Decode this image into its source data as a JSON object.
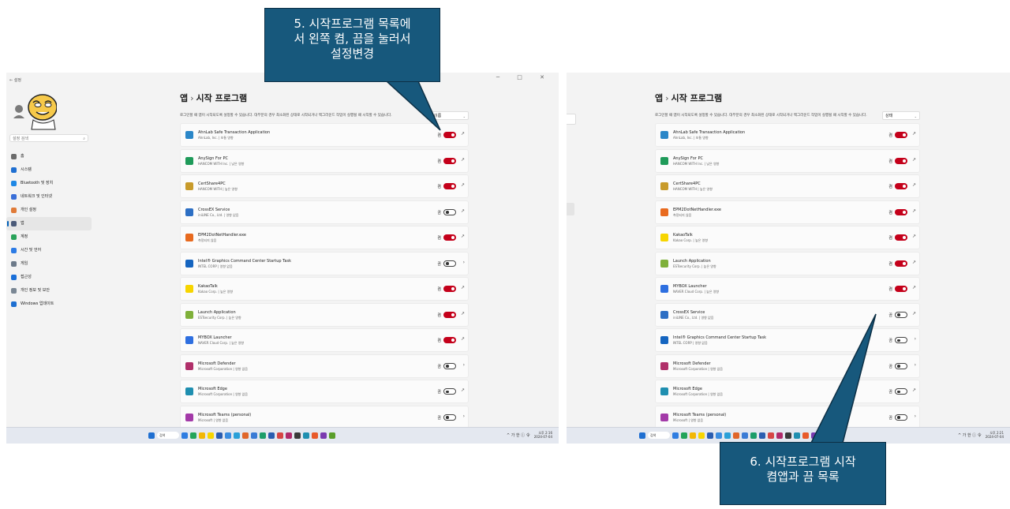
{
  "window": {
    "back_label": "← 설정",
    "controls": "─ □ ✕"
  },
  "sidebar": {
    "search_placeholder": "설정 검색",
    "items": [
      {
        "label": "홈",
        "icon": "home-icon",
        "color": "#6b6b6b"
      },
      {
        "label": "시스템",
        "icon": "system-icon",
        "color": "#1f6fd1"
      },
      {
        "label": "Bluetooth 및 장치",
        "icon": "bluetooth-icon",
        "color": "#1e88e5"
      },
      {
        "label": "네트워크 및 인터넷",
        "icon": "network-icon",
        "color": "#3a6fd8"
      },
      {
        "label": "개인 설정",
        "icon": "brush-icon",
        "color": "#e07b39"
      },
      {
        "label": "앱",
        "icon": "apps-icon",
        "color": "#4a5a78",
        "selected": true
      },
      {
        "label": "계정",
        "icon": "accounts-icon",
        "color": "#2aa35a"
      },
      {
        "label": "시간 및 언어",
        "icon": "time-language-icon",
        "color": "#2c7be5"
      },
      {
        "label": "게임",
        "icon": "gaming-icon",
        "color": "#6c7a89"
      },
      {
        "label": "접근성",
        "icon": "accessibility-icon",
        "color": "#1a6fd8"
      },
      {
        "label": "개인 정보 및 보안",
        "icon": "shield-icon",
        "color": "#7a8794"
      },
      {
        "label": "Windows 업데이트",
        "icon": "update-icon",
        "color": "#1e6fd1"
      }
    ]
  },
  "main": {
    "breadcrumb_root": "앱",
    "breadcrumb_sep": "›",
    "page_title": "시작 프로그램",
    "description": "로그인할 때 앱이 시작되도록 설정할 수 있습니다. 대부분의 경우 최소화된 상태로 시작되거나 백그라운드 작업이 실행될 때 시작할 수 있습니다.",
    "sort_label": "이름",
    "apps": [
      {
        "name": "AhnLab Safe Transaction Application",
        "sub": "AhnLab, Inc. | 보통 영향",
        "state": "켬",
        "on": true,
        "action": "↗",
        "icon_color": "#2b87c8"
      },
      {
        "name": "AnySign For PC",
        "sub": "HANCOM WITH Inc. | 낮은 영향",
        "state": "켬",
        "on": true,
        "action": "↗",
        "icon_color": "#1f9b5a"
      },
      {
        "name": "CertShare4PC",
        "sub": "HANCOM WITH | 높은 영향",
        "state": "켬",
        "on": true,
        "action": "↗",
        "icon_color": "#c89b2b"
      },
      {
        "name": "CrossEX Service",
        "sub": "iniLINE Co., Ltd. | 영향 없음",
        "state": "끔",
        "on": false,
        "action": "↗",
        "icon_color": "#2d6fc4"
      },
      {
        "name": "EPM2DotNetHandler.exe",
        "sub": "측정되지 않음",
        "state": "켬",
        "on": true,
        "action": "↗",
        "icon_color": "#e86a1f"
      },
      {
        "name": "Intel® Graphics Command Center Startup Task",
        "sub": "INTEL CORP | 영향 없음",
        "state": "끔",
        "on": false,
        "action": "›",
        "icon_color": "#1565c0"
      },
      {
        "name": "KakaoTalk",
        "sub": "Kakao Corp. | 높은 영향",
        "state": "켬",
        "on": true,
        "action": "↗",
        "icon_color": "#f7d500"
      },
      {
        "name": "Launch Application",
        "sub": "ESTsecurity Corp. | 높은 영향",
        "state": "켬",
        "on": true,
        "action": "↗",
        "icon_color": "#7fb03a"
      },
      {
        "name": "MYBOX Launcher",
        "sub": "NAVER Cloud Corp. | 높은 영향",
        "state": "켬",
        "on": true,
        "action": "↗",
        "icon_color": "#2e6fe0"
      },
      {
        "name": "Microsoft Defender",
        "sub": "Microsoft Corporation | 영향 없음",
        "state": "끔",
        "on": false,
        "action": "›",
        "icon_color": "#b0306a"
      },
      {
        "name": "Microsoft Edge",
        "sub": "Microsoft Corporation | 영향 없음",
        "state": "끔",
        "on": false,
        "action": "↗",
        "icon_color": "#1f8fb0"
      },
      {
        "name": "Microsoft Teams (personal)",
        "sub": "Microsoft | 영향 없음",
        "state": "끔",
        "on": false,
        "action": "›",
        "icon_color": "#a33aa8"
      }
    ]
  },
  "main_right": {
    "sort_label": "상태",
    "apps": [
      {
        "name": "AhnLab Safe Transaction Application",
        "sub": "AhnLab, Inc. | 보통 영향",
        "state": "켬",
        "on": true,
        "action": "↗",
        "icon_color": "#2b87c8"
      },
      {
        "name": "AnySign For PC",
        "sub": "HANCOM WITH Inc. | 낮은 영향",
        "state": "켬",
        "on": true,
        "action": "↗",
        "icon_color": "#1f9b5a"
      },
      {
        "name": "CertShare4PC",
        "sub": "HANCOM WITH | 높은 영향",
        "state": "켬",
        "on": true,
        "action": "↗",
        "icon_color": "#c89b2b"
      },
      {
        "name": "EPM2DotNetHandler.exe",
        "sub": "측정되지 않음",
        "state": "켬",
        "on": true,
        "action": "↗",
        "icon_color": "#e86a1f"
      },
      {
        "name": "KakaoTalk",
        "sub": "Kakao Corp. | 높은 영향",
        "state": "켬",
        "on": true,
        "action": "↗",
        "icon_color": "#f7d500"
      },
      {
        "name": "Launch Application",
        "sub": "ESTsecurity Corp. | 높은 영향",
        "state": "켬",
        "on": true,
        "action": "↗",
        "icon_color": "#7fb03a"
      },
      {
        "name": "MYBOX Launcher",
        "sub": "NAVER Cloud Corp. | 높은 영향",
        "state": "켬",
        "on": true,
        "action": "↗",
        "icon_color": "#2e6fe0"
      },
      {
        "name": "CrossEX Service",
        "sub": "iniLINE Co., Ltd. | 영향 없음",
        "state": "끔",
        "on": false,
        "action": "↗",
        "icon_color": "#2d6fc4"
      },
      {
        "name": "Intel® Graphics Command Center Startup Task",
        "sub": "INTEL CORP | 영향 없음",
        "state": "끔",
        "on": false,
        "action": "›",
        "icon_color": "#1565c0"
      },
      {
        "name": "Microsoft Defender",
        "sub": "Microsoft Corporation | 영향 없음",
        "state": "끔",
        "on": false,
        "action": "›",
        "icon_color": "#b0306a"
      },
      {
        "name": "Microsoft Edge",
        "sub": "Microsoft Corporation | 영향 없음",
        "state": "끔",
        "on": false,
        "action": "↗",
        "icon_color": "#1f8fb0"
      },
      {
        "name": "Microsoft Teams (personal)",
        "sub": "Microsoft | 영향 없음",
        "state": "끔",
        "on": false,
        "action": "›",
        "icon_color": "#a33aa8"
      }
    ]
  },
  "taskbar": {
    "search_label": "검색",
    "tray_left": "^ 가 한 ⓘ 令",
    "time": "오후 2:16",
    "date": "2024-07-04",
    "time_right": "오후 2:21",
    "date_right": "2024-07-04",
    "icon_colors": [
      "#2f7de1",
      "#23a45a",
      "#f2b705",
      "#f7d500",
      "#2a5db0",
      "#3b8de0",
      "#2aa0d8",
      "#e0662a",
      "#3a7bd5",
      "#1c9e6a",
      "#2a5db0",
      "#d64545",
      "#b02a6a",
      "#3a3a3a",
      "#1f8fb0",
      "#e85a2a",
      "#7a3ab0",
      "#5a9e2a"
    ]
  },
  "annotations": {
    "callout_5": [
      "5. 시작프로그램 목록에",
      "서 왼쪽 켬, 끔을 눌러서",
      "설정변경"
    ],
    "callout_6": [
      "6. 시작프로그램 시작",
      "켬앱과 끔 목록"
    ],
    "callout_color": "#17587c"
  }
}
